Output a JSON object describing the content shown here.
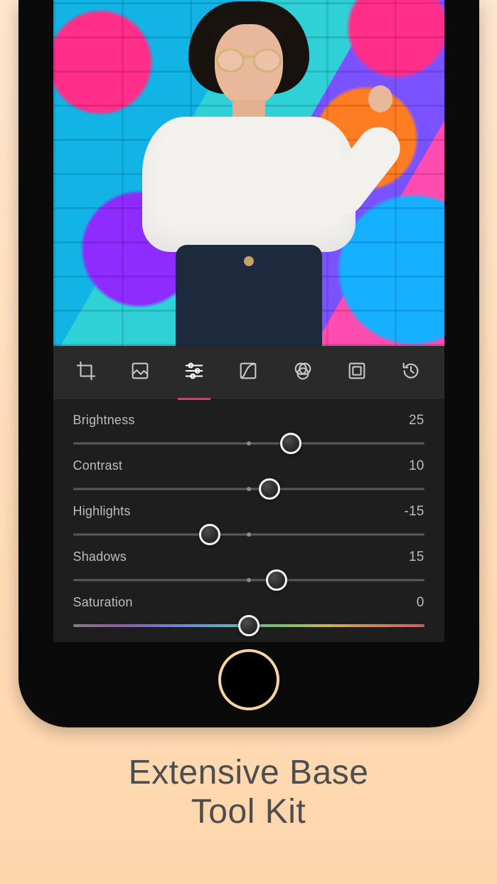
{
  "marketing": {
    "caption_line1": "Extensive Base",
    "caption_line2": "Tool Kit"
  },
  "toolbar": {
    "active_index": 2,
    "tabs": [
      {
        "name": "crop-icon"
      },
      {
        "name": "photo-icon"
      },
      {
        "name": "adjust-sliders-icon"
      },
      {
        "name": "curves-icon"
      },
      {
        "name": "color-channels-icon"
      },
      {
        "name": "vignette-icon"
      },
      {
        "name": "history-icon"
      }
    ],
    "accent_color": "#FF2D55"
  },
  "sliders": [
    {
      "label": "Brightness",
      "value": 25,
      "display": "25",
      "position_pct": 62,
      "gradient": false
    },
    {
      "label": "Contrast",
      "value": 10,
      "display": "10",
      "position_pct": 56,
      "gradient": false
    },
    {
      "label": "Highlights",
      "value": -15,
      "display": "-15",
      "position_pct": 39,
      "gradient": false
    },
    {
      "label": "Shadows",
      "value": 15,
      "display": "15",
      "position_pct": 58,
      "gradient": false
    },
    {
      "label": "Saturation",
      "value": 0,
      "display": "0",
      "position_pct": 50,
      "gradient": true
    }
  ]
}
